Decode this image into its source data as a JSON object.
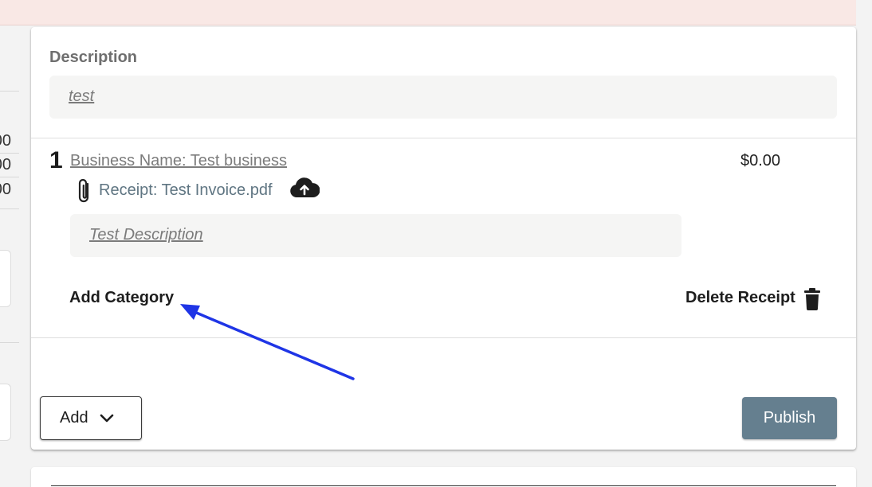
{
  "left_panel": {
    "values": [
      "00",
      "00",
      "00"
    ]
  },
  "description": {
    "label": "Description",
    "value": "test"
  },
  "receipt": {
    "number": "1",
    "business_name": "Business Name: Test business",
    "amount": "$0.00",
    "file_link": "Receipt: Test Invoice.pdf",
    "description": "Test Description",
    "add_category_label": "Add Category",
    "delete_label": "Delete Receipt"
  },
  "footer": {
    "add_label": "Add",
    "publish_label": "Publish"
  },
  "icons": [
    "paperclip-icon",
    "cloud-upload-icon",
    "trash-icon",
    "chevron-down-icon"
  ],
  "colors": {
    "banner": "#f9e8e5",
    "publish_button": "#657f8f",
    "link": "#5f7582",
    "annotation_arrow": "#1f35e6"
  }
}
